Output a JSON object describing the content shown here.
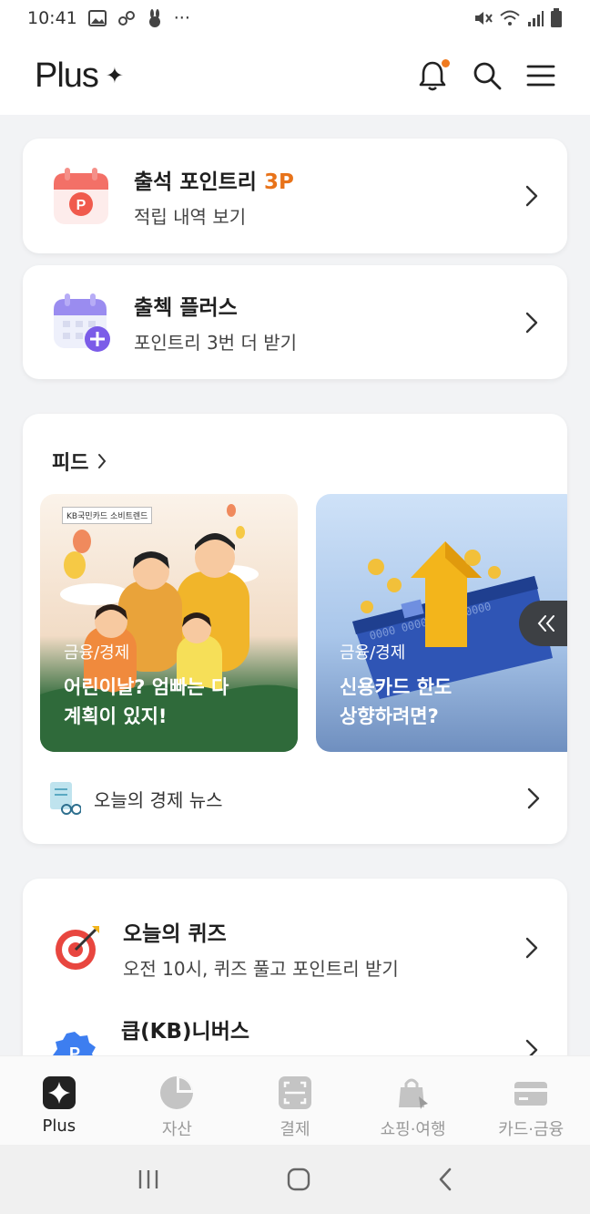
{
  "status_bar": {
    "time": "10:41",
    "dots": "···"
  },
  "header": {
    "logo": "Plus",
    "logo_mark": "✦"
  },
  "attendance": {
    "title": "출석 포인트리 ",
    "points": "3P",
    "subtitle": "적립 내역 보기"
  },
  "attendance_plus": {
    "title": "출첵 플러스",
    "subtitle": "포인트리 3번 더 받기"
  },
  "feed": {
    "title": "피드",
    "tiles": [
      {
        "category": "금융/경제",
        "line1": "어린이날? 엄빠는 다",
        "line2": "계획이 있지!",
        "badge": "KB국민카드 소비트렌드"
      },
      {
        "category": "금융/경제",
        "line1": "신용카드 한도",
        "line2": "상향하려면?",
        "card_number": "0000 0000 0000 0000"
      }
    ],
    "news_label": "오늘의 경제 뉴스"
  },
  "quiz": {
    "title": "오늘의 퀴즈",
    "subtitle": "오전 10시, 퀴즈 풀고 포인트리 받기"
  },
  "kb_business": {
    "title": "큽(KB)니버스"
  },
  "tabs": [
    {
      "label": "Plus",
      "icon": "plus-sparkle-icon"
    },
    {
      "label": "자산",
      "icon": "pie-chart-icon"
    },
    {
      "label": "결제",
      "icon": "scan-icon"
    },
    {
      "label": "쇼핑·여행",
      "icon": "shopping-bag-icon"
    },
    {
      "label": "카드·금융",
      "icon": "card-icon"
    }
  ],
  "colors": {
    "accent": "#e8731a",
    "notification_dot": "#f07a1f"
  }
}
